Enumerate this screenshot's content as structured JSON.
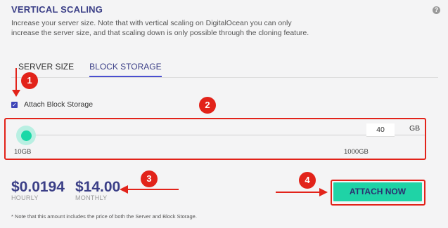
{
  "section": {
    "title": "VERTICAL SCALING",
    "description": "Increase your server size. Note that with vertical scaling on DigitalOcean you can only increase the server size, and that scaling down is only possible through the cloning feature.",
    "help_icon": "question-circle-icon"
  },
  "tabs": [
    {
      "label": "SERVER SIZE",
      "active": false
    },
    {
      "label": "BLOCK STORAGE",
      "active": true
    }
  ],
  "attach_checkbox": {
    "label": "Attach Block Storage",
    "checked": true
  },
  "storage_slider": {
    "value_gb": 40,
    "min_gb": 10,
    "max_gb": 1000,
    "input_value": "40",
    "unit": "GB",
    "min_label": "10GB",
    "max_label": "1000GB"
  },
  "pricing": {
    "hourly": "$0.0194",
    "hourly_label": "HOURLY",
    "monthly": "$14.00",
    "monthly_label": "MONTHLY"
  },
  "attach_button": {
    "label": "ATTACH NOW"
  },
  "footnote": "* Note that this amount includes the price of both the Server and Block Storage.",
  "annotations": {
    "markers": [
      "1",
      "2",
      "3",
      "4"
    ],
    "color": "#e2231a"
  },
  "colors": {
    "accent": "#3b3f87",
    "button": "#1fd3a6",
    "slider_thumb": "#1bd8a7"
  }
}
